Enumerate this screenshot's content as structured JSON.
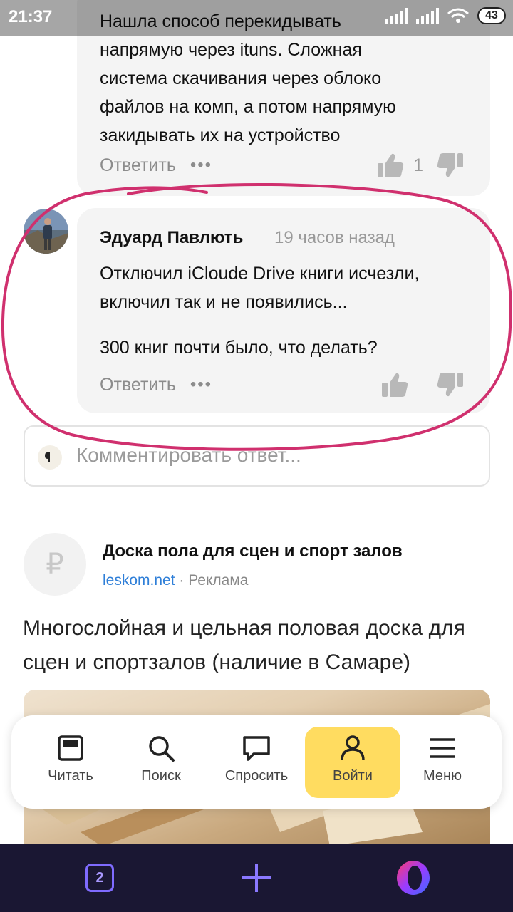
{
  "status_bar": {
    "time": "21:37",
    "battery": "43"
  },
  "comment1": {
    "text_lines": [
      "Нашла способ перекидывать",
      "напрямую через ituns. Сложная",
      "система скачивания через облоко",
      "файлов на комп, а потом напрямую",
      "закидывать их на устройство"
    ],
    "reply_label": "Ответить",
    "more_label": "•••",
    "like_count": "1"
  },
  "comment2": {
    "author": "Эдуард Павлють",
    "time_ago": "19 часов назад",
    "line1": "Отключил iCloude Drive книги исчезли,",
    "line2": "включил так и не появились...",
    "line3": "300 книг почти было, что делать?",
    "reply_label": "Ответить",
    "more_label": "•••"
  },
  "comment_input": {
    "placeholder": "Комментировать ответ..."
  },
  "ad": {
    "logo_symbol": "₽",
    "title": "Доска пола для сцен и спорт залов",
    "domain": "leskom.net",
    "separator": " · ",
    "label": "Реклама",
    "description": "Многослойная и цельная половая доска для сцен и спортзалов (наличие в Самаре)"
  },
  "nav": {
    "items": [
      {
        "label": "Читать",
        "icon": "read-icon"
      },
      {
        "label": "Поиск",
        "icon": "search-icon"
      },
      {
        "label": "Спросить",
        "icon": "ask-icon"
      },
      {
        "label": "Войти",
        "icon": "user-icon",
        "active": true
      },
      {
        "label": "Меню",
        "icon": "menu-icon"
      }
    ]
  },
  "browser_bar": {
    "tabs_count": "2"
  },
  "colors": {
    "accent_yellow": "#ffdc60",
    "highlight_pink": "#d0306e",
    "link_blue": "#2f7fd8",
    "opera_bar": "#1a1733"
  }
}
